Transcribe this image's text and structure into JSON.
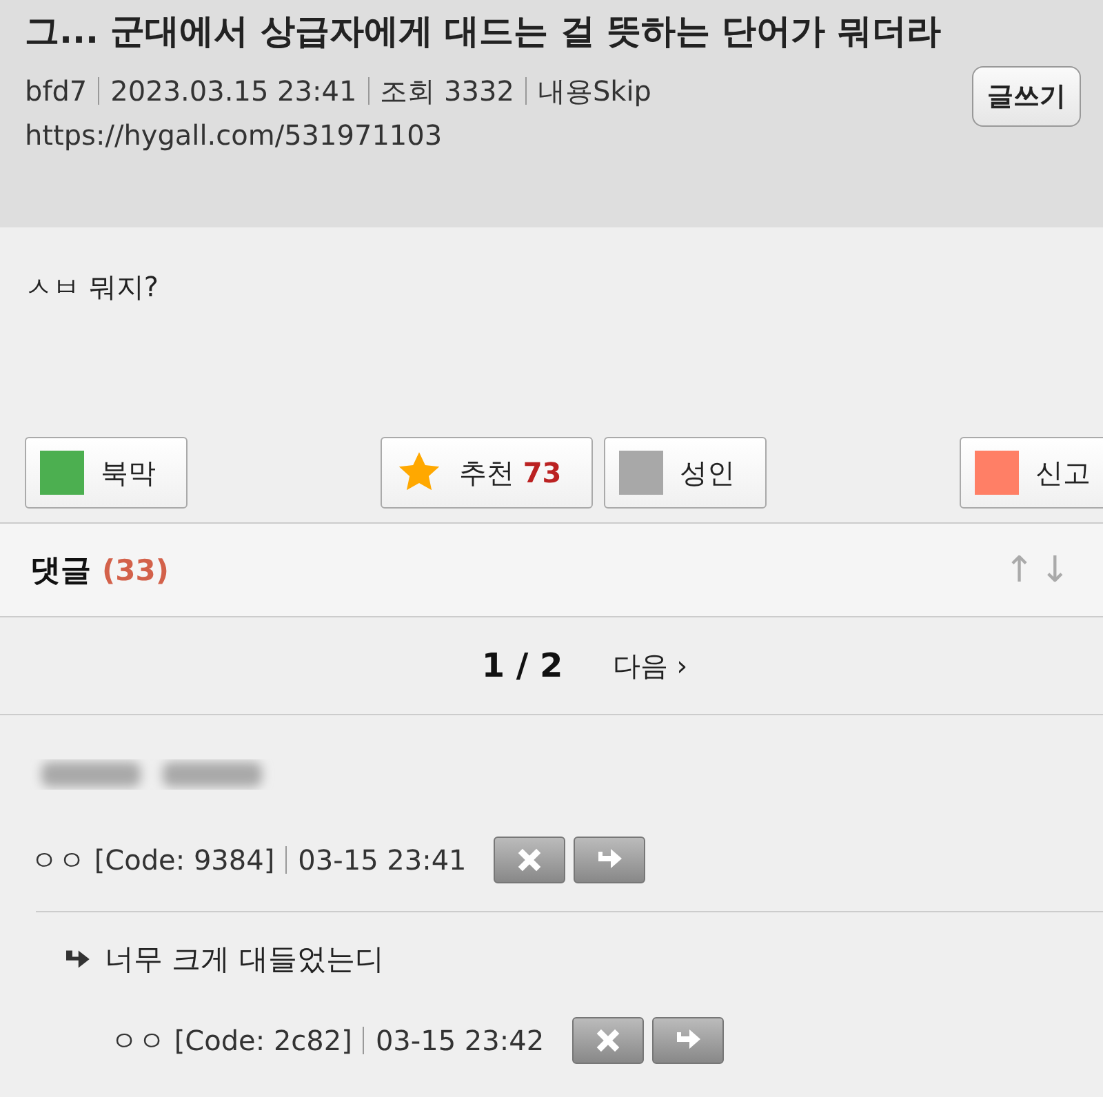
{
  "post": {
    "title": "그... 군대에서 상급자에게 대드는 걸 뜻하는 단어가 뭐더라",
    "write_button": "글쓰기",
    "meta": [
      "bfd7",
      "2023.03.15 23:41",
      "조회 3332",
      "내용Skip"
    ],
    "url": "https://hygall.com/531971103",
    "body": "ㅅㅂ 뭐지?"
  },
  "actions": [
    {
      "kind": "square",
      "color": "#4caf50",
      "label": "북막"
    },
    {
      "kind": "star",
      "label": "추천",
      "count": "73"
    },
    {
      "kind": "square",
      "color": "#a8a8a8",
      "label": "성인"
    },
    {
      "kind": "square",
      "color": "#ff7f66",
      "label": "신고"
    }
  ],
  "comments_header": {
    "label": "댓글",
    "count": "(33)",
    "sort_up": "↑",
    "sort_down": "↓"
  },
  "pagination": {
    "page": "1 / 2",
    "next": "다음 ›"
  },
  "comments": [
    {
      "kind": "blurred",
      "author": "ㅇㅇ [Code: 9384]",
      "time": "03-15 23:41"
    },
    {
      "kind": "reply",
      "text": "너무 크게 대들었는디",
      "author": "ㅇㅇ [Code: 2c82]",
      "time": "03-15 23:42"
    }
  ]
}
